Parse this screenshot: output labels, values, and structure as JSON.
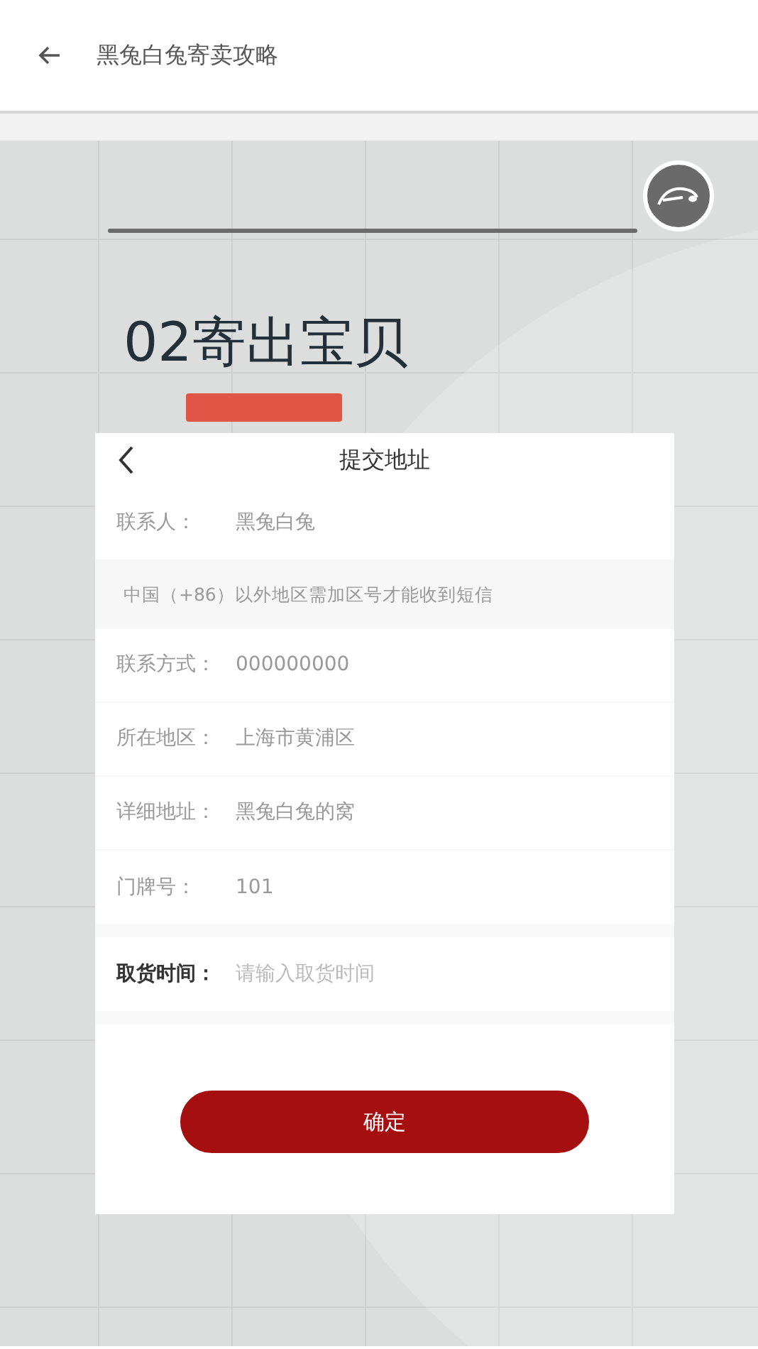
{
  "header": {
    "title": "黑兔白兔寄卖攻略"
  },
  "banner": {
    "heading": "02寄出宝贝",
    "form": {
      "title": "提交地址",
      "rows": [
        {
          "kind": "value",
          "label": "联系人：",
          "value": "黑兔白兔"
        },
        {
          "kind": "notice",
          "text": "中国（+86）以外地区需加区号才能收到短信"
        },
        {
          "kind": "value",
          "label": "联系方式：",
          "value": "000000000"
        },
        {
          "kind": "value",
          "label": "所在地区：",
          "value": "上海市黄浦区"
        },
        {
          "kind": "value",
          "label": "详细地址：",
          "value": "黑兔白兔的窝"
        },
        {
          "kind": "value",
          "label": "门牌号：",
          "value": "101"
        },
        {
          "kind": "input",
          "label": "取货时间：",
          "placeholder": "请输入取货时间"
        }
      ],
      "button": "确定"
    }
  }
}
